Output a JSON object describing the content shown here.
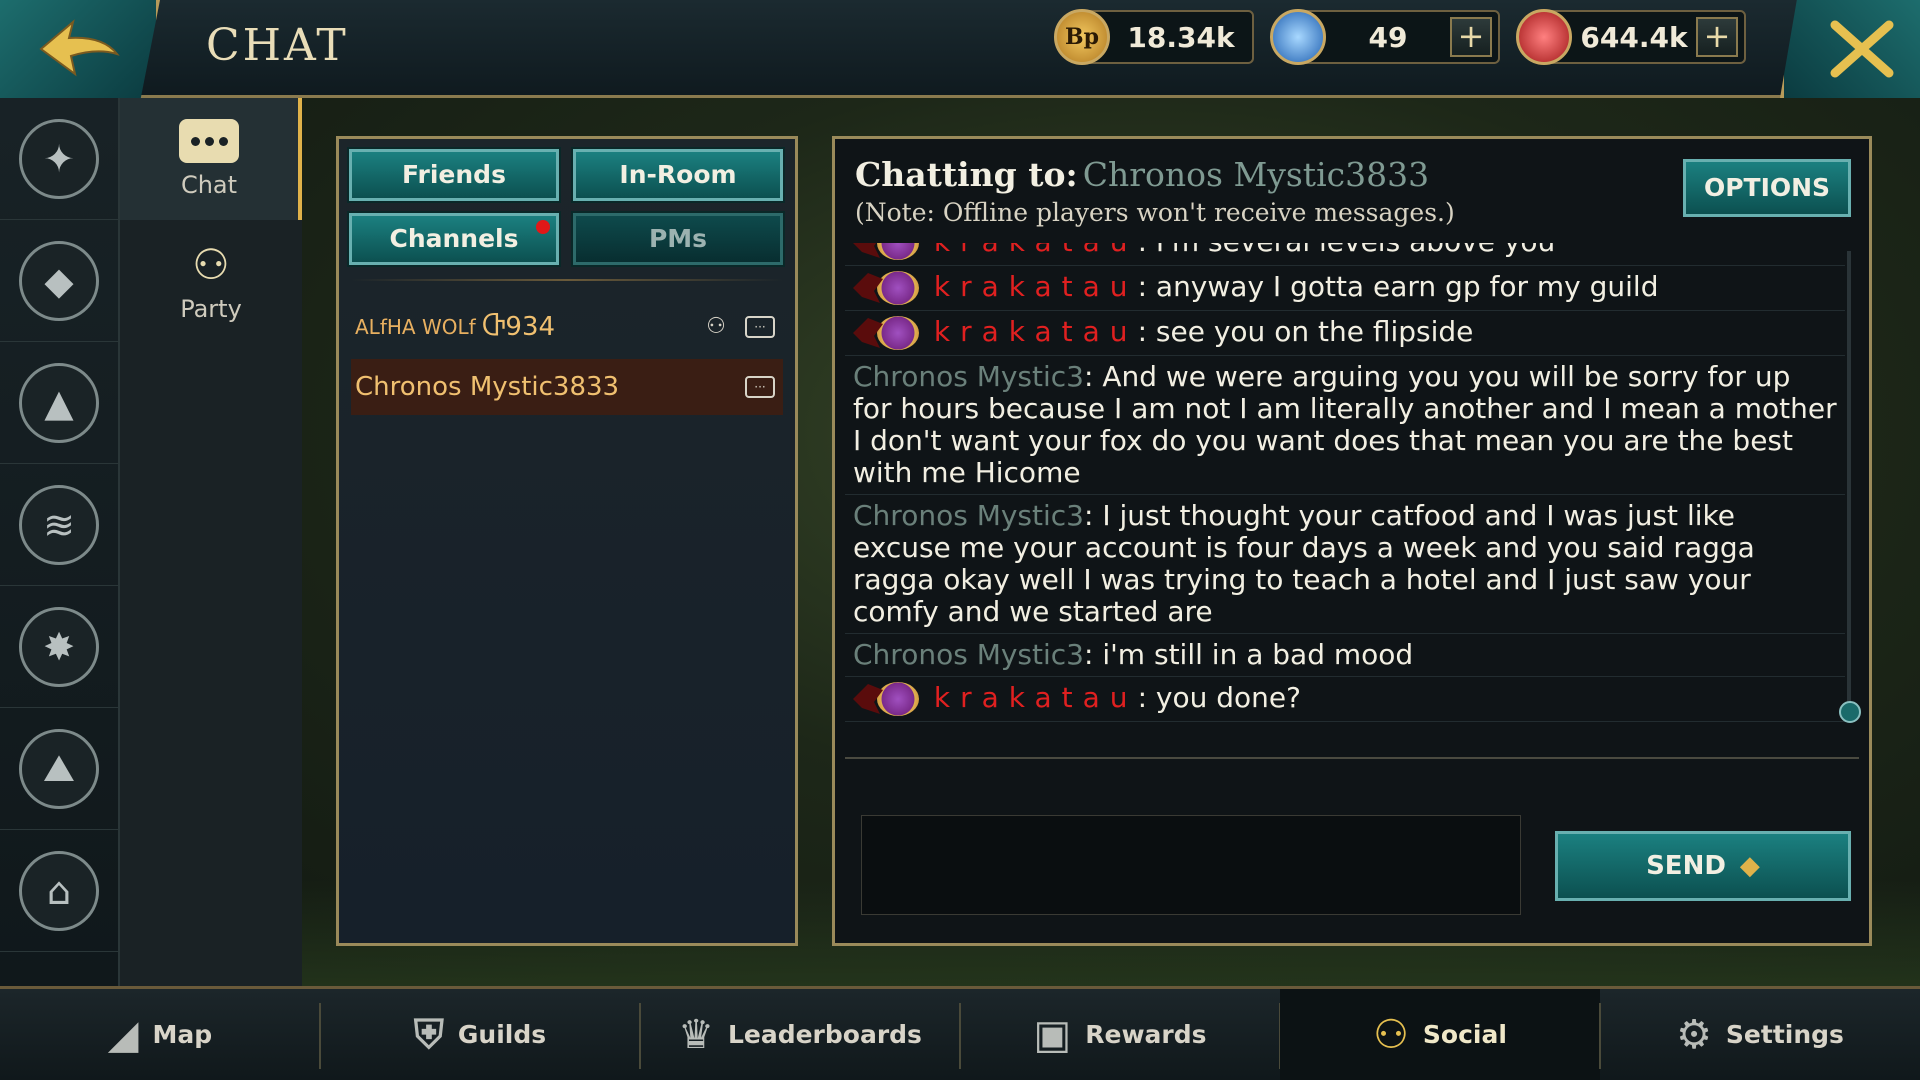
{
  "header": {
    "title": "CHAT",
    "currencies": [
      {
        "icon": "bp-coin-icon",
        "symbol": "Bp",
        "amount": "18.34k",
        "has_plus": false,
        "color": "#d9a83a"
      },
      {
        "icon": "blue-gem-icon",
        "symbol": "",
        "amount": "49",
        "has_plus": true,
        "color": "#3a7fd9"
      },
      {
        "icon": "red-gem-icon",
        "symbol": "",
        "amount": "644.4k",
        "has_plus": true,
        "color": "#d93a3a"
      }
    ],
    "plus_label": "+"
  },
  "rail": {
    "icons": [
      "paw-icon",
      "wolf-head-icon",
      "wolf-howl-icon",
      "claw-marks-icon",
      "wolf-pack-icon",
      "mountain-icon",
      "basket-icon"
    ],
    "glyphs": [
      "✦",
      "◆",
      "▲",
      "≋",
      "✸",
      "⛰",
      "⌂"
    ]
  },
  "sidetabs": {
    "chat_label": "Chat",
    "party_label": "Party",
    "party_glyph": "⚇"
  },
  "contacts": {
    "tabs": {
      "friends": "Friends",
      "in_room": "In-Room",
      "channels": "Channels",
      "pms": "PMs"
    },
    "rows": [
      {
        "name": "ALfHA WOLf",
        "extra": "Ⴇ934"
      },
      {
        "name": "Chronos Mystic3833",
        "extra": ""
      }
    ],
    "party_glyph": "⚇",
    "msg_glyph": "···"
  },
  "chat": {
    "label": "Chatting to:",
    "target": "Chronos Mystic3833",
    "note": "(Note: Offline players won't receive messages.)",
    "options_label": "OPTIONS",
    "send_label": "SEND",
    "send_arrow": "◆",
    "messages": [
      {
        "sender": "krakatau",
        "text": "I'm several levels above you",
        "kind": "k"
      },
      {
        "sender": "krakatau",
        "text": "anyway I gotta earn gp for my guild",
        "kind": "k"
      },
      {
        "sender": "krakatau",
        "text": "see you on the flipside",
        "kind": "k"
      },
      {
        "sender": "Chronos Mystic3",
        "text": "And we were arguing you you will be sorry for up for hours because I am not I am literally another and I mean a mother I don't want your fox do you want does that mean you are the best with me Hicome",
        "kind": "c"
      },
      {
        "sender": "Chronos Mystic3",
        "text": "I just thought your catfood and I was just like excuse me your account is four days a week and you said ragga ragga okay well I was trying to teach a hotel and I just saw your comfy and we started are",
        "kind": "c"
      },
      {
        "sender": "Chronos Mystic3",
        "text": "i'm still in a bad mood",
        "kind": "c"
      },
      {
        "sender": "krakatau",
        "text": "you done?",
        "kind": "k"
      }
    ]
  },
  "bottomnav": [
    {
      "label": "Map",
      "icon": "map-icon",
      "glyph": "◢"
    },
    {
      "label": "Guilds",
      "icon": "guild-shield-icon",
      "glyph": "⛨"
    },
    {
      "label": "Leaderboards",
      "icon": "crown-icon",
      "glyph": "♛"
    },
    {
      "label": "Rewards",
      "icon": "chest-icon",
      "glyph": "▣"
    },
    {
      "label": "Social",
      "icon": "people-icon",
      "glyph": "⚇"
    },
    {
      "label": "Settings",
      "icon": "gear-icon",
      "glyph": "⚙"
    }
  ]
}
